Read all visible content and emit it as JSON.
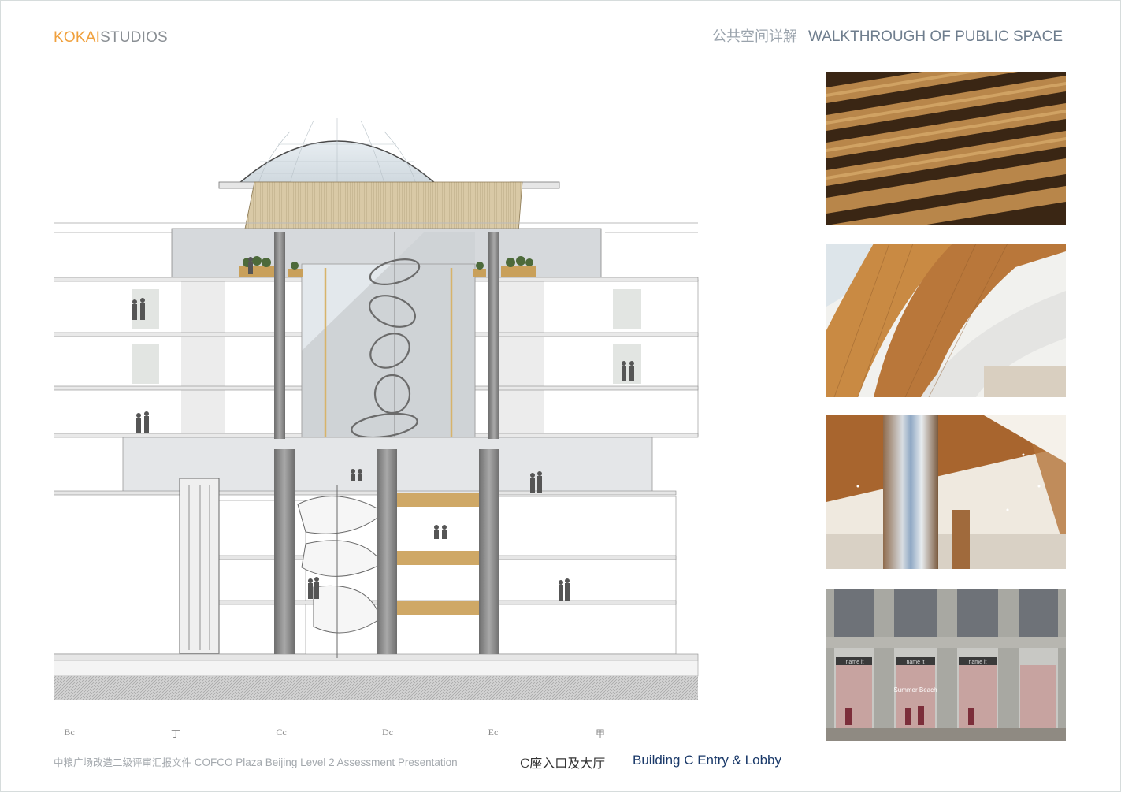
{
  "brand": {
    "part1": "KOKAI",
    "part2": "STUDIOS"
  },
  "header": {
    "title_zh": "公共空间详解",
    "title_en": "WALKTHROUGH OF PUBLIC SPACE"
  },
  "axis_labels": [
    "Bc",
    "丁",
    "Cc",
    "Dc",
    "Ec",
    "甲"
  ],
  "photos": [
    {
      "name": "wood-slat-ceiling"
    },
    {
      "name": "curved-wood-balcony"
    },
    {
      "name": "column-with-wood-ceiling"
    },
    {
      "name": "shopfront",
      "signs": [
        "name it",
        "name it",
        "name it"
      ],
      "display_text": "Summer Beach"
    }
  ],
  "footer": {
    "doc_zh": "中粮广场改造二级评审汇报文件",
    "doc_en": "COFCO Plaza Beijing Level 2 Assessment Presentation",
    "caption_zh": "C座入口及大厅",
    "caption_en": "Building C Entry & Lobby"
  },
  "colors": {
    "accent": "#f0a03c",
    "navy": "#1b3a6a",
    "wood": "#c9a05a"
  }
}
